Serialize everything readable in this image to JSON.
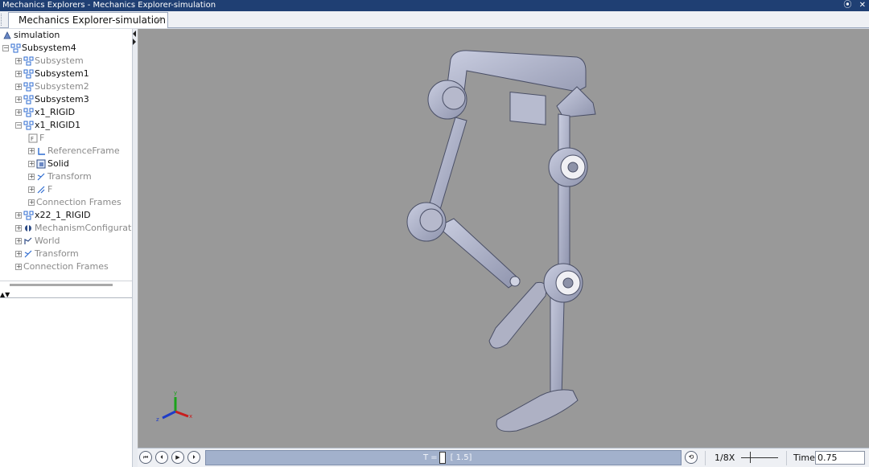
{
  "window": {
    "title": "Mechanics Explorers - Mechanics Explorer-simulation",
    "pin_icon": "⦿",
    "close_icon": "✕"
  },
  "tab": {
    "label": "Mechanics Explorer-simulation",
    "close": "✕"
  },
  "tree": {
    "nodes": [
      {
        "label": "simulation",
        "depth": 0,
        "icon": "model-icon",
        "expander": "",
        "dim": false
      },
      {
        "label": "Subsystem4",
        "depth": 0,
        "icon": "subsystem-icon",
        "expander": "−",
        "dim": false
      },
      {
        "label": "Subsystem",
        "depth": 1,
        "icon": "subsystem-icon",
        "expander": "+",
        "dim": true
      },
      {
        "label": "Subsystem1",
        "depth": 1,
        "icon": "subsystem-icon",
        "expander": "+",
        "dim": false
      },
      {
        "label": "Subsystem2",
        "depth": 1,
        "icon": "subsystem-icon",
        "expander": "+",
        "dim": true
      },
      {
        "label": "Subsystem3",
        "depth": 1,
        "icon": "subsystem-icon",
        "expander": "+",
        "dim": false
      },
      {
        "label": "x1_RIGID",
        "depth": 1,
        "icon": "subsystem-icon",
        "expander": "+",
        "dim": false
      },
      {
        "label": "x1_RIGID1",
        "depth": 1,
        "icon": "subsystem-icon",
        "expander": "−",
        "dim": false
      },
      {
        "label": "F",
        "depth": 2,
        "icon": "port-icon",
        "expander": "",
        "dim": true
      },
      {
        "label": "ReferenceFrame",
        "depth": 2,
        "icon": "reference-frame-icon",
        "expander": "+",
        "dim": true
      },
      {
        "label": "Solid",
        "depth": 2,
        "icon": "solid-icon",
        "expander": "+",
        "dim": false
      },
      {
        "label": "Transform",
        "depth": 2,
        "icon": "transform-icon",
        "expander": "+",
        "dim": true
      },
      {
        "label": "F",
        "depth": 2,
        "icon": "frame-icon",
        "expander": "+",
        "dim": true
      },
      {
        "label": "Connection Frames",
        "depth": 2,
        "icon": "",
        "expander": "+",
        "dim": true
      },
      {
        "label": "x22_1_RIGID",
        "depth": 1,
        "icon": "subsystem-icon",
        "expander": "+",
        "dim": false
      },
      {
        "label": "MechanismConfiguratic",
        "depth": 1,
        "icon": "mechanism-config-icon",
        "expander": "+",
        "dim": true
      },
      {
        "label": "World",
        "depth": 1,
        "icon": "world-icon",
        "expander": "+",
        "dim": true
      },
      {
        "label": "Transform",
        "depth": 1,
        "icon": "transform-icon",
        "expander": "+",
        "dim": true
      },
      {
        "label": "Connection Frames",
        "depth": 1,
        "icon": "",
        "expander": "+",
        "dim": true
      }
    ]
  },
  "pager": {
    "label": "▲▼"
  },
  "viewport": {
    "axes": {
      "x_label": "x",
      "y_label": "y",
      "z_label": "z"
    }
  },
  "playback": {
    "rewind": "⏮",
    "step_back": "⏴",
    "play": "▶",
    "step_forward": "⏵",
    "time_prefix": "T =",
    "time_range": "[ 1.5]",
    "loop": "⟲",
    "speed": "1/8X",
    "time_label": "Time",
    "time_value": "0.75"
  }
}
